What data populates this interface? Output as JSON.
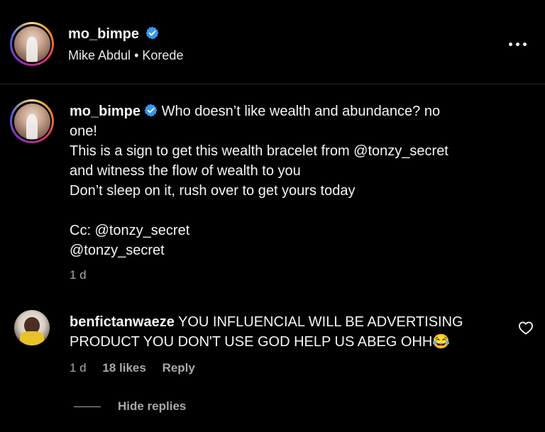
{
  "header": {
    "username": "mo_bimpe",
    "collab_1": "Mike Abdul",
    "separator": "•",
    "collab_2": "Korede"
  },
  "post": {
    "username": "mo_bimpe",
    "caption_lines": [
      "Who doesn’t like wealth and abundance? no",
      "one!",
      "This is a sign to get this wealth bracelet from @tonzy_secret",
      "and witness the flow of wealth to you",
      "Don’t sleep on it, rush over to get yours today",
      "",
      "Cc: @tonzy_secret",
      "@tonzy_secret"
    ],
    "time": "1 d"
  },
  "comment": {
    "username": "benfictanwaeze",
    "text_line_1": "YOU INFLUENCIAL WILL BE ADVERTISING",
    "text_line_2": "PRODUCT YOU DON'T USE GOD HELP US ABEG OHH😂",
    "time": "1 d",
    "likes": "18 likes",
    "reply_label": "Reply"
  },
  "replies": {
    "hide_label": "Hide replies"
  },
  "colors": {
    "background": "#000000",
    "verified": "#3897f0",
    "secondary_text": "#a8a8a8"
  },
  "icons": [
    "verified-badge-icon",
    "more-options-icon",
    "heart-icon"
  ]
}
